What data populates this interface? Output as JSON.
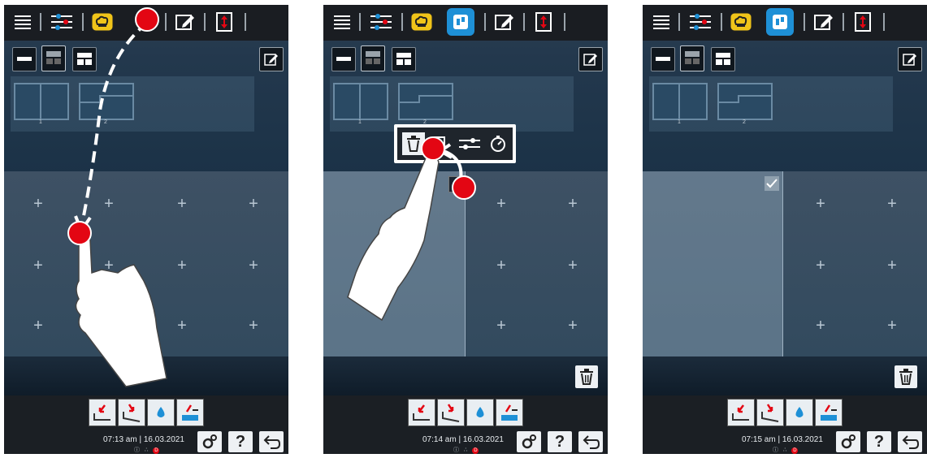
{
  "screens": [
    {
      "time": "07:13 am",
      "date": "16.03.2021",
      "selected_tab": "cooking"
    },
    {
      "time": "07:14 am",
      "date": "16.03.2021",
      "selected_tab": "layout"
    },
    {
      "time": "07:15 am",
      "date": "16.03.2021",
      "selected_tab": "layout"
    }
  ],
  "presets": [
    "1",
    "2"
  ],
  "separator": "|",
  "status_icons": [
    "info-icon",
    "network-icon",
    "alert-d-icon"
  ],
  "status_alert_letter": "D",
  "context_menu": [
    "trash-icon",
    "duplicate-icon",
    "settings-icon",
    "timer-icon"
  ],
  "help_label": "?",
  "colors": {
    "accent": "#1e90d6",
    "marker": "#e30613",
    "topbar": "#1a1d22",
    "cooking_tab": "#f0c419"
  }
}
